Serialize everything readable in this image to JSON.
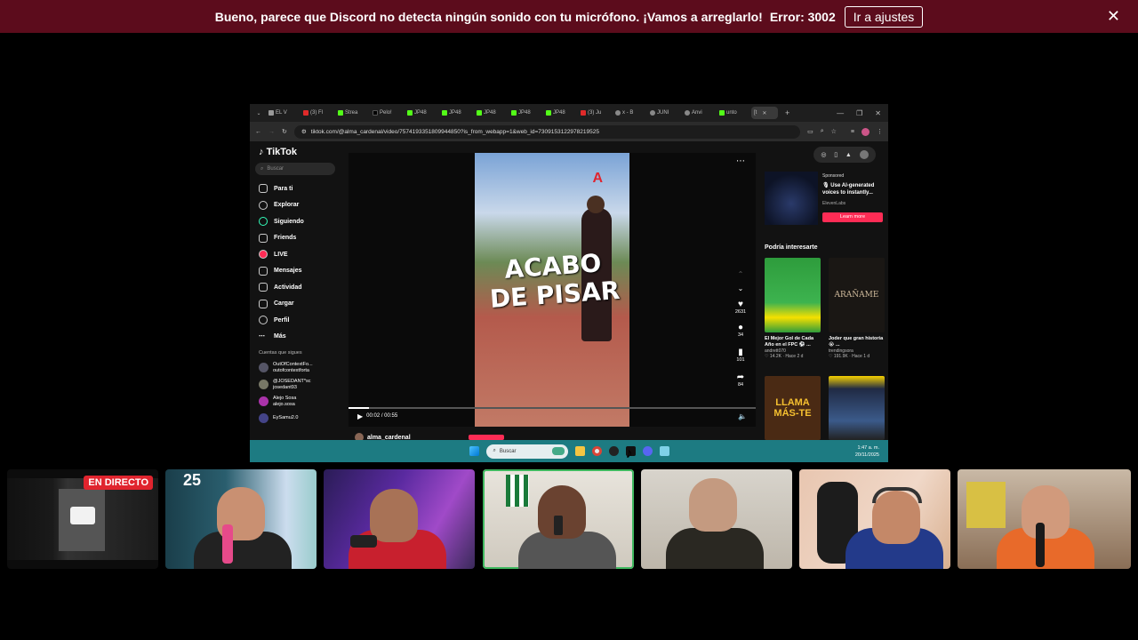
{
  "banner": {
    "message": "Bueno, parece que Discord no detecta ningún sonido con tu micrófono. ¡Vamos a arreglarlo!",
    "error": "Error: 3002",
    "button": "Ir a ajustes",
    "close_icon": "close-icon"
  },
  "browser": {
    "tabs": [
      "EL V",
      "(3) Fl",
      "Strea",
      "Pelo!",
      "JP48",
      "JP48",
      "JP48",
      "JP48",
      "JP48",
      "(3) Ju",
      "x - B",
      "JUNI",
      "Anvi",
      "unto",
      "[t"
    ],
    "url": "tiktok.com/@alma_cardenal/video/7574193351809944850?is_from_webapp=1&web_id=7309153122978219525"
  },
  "tiktok": {
    "logo": "TikTok",
    "search_placeholder": "Buscar",
    "nav": [
      "Para ti",
      "Explorar",
      "Siguiendo",
      "Friends",
      "LIVE",
      "Mensajes",
      "Actividad",
      "Cargar",
      "Perfil",
      "Más"
    ],
    "following_header": "Cuentas que sigues",
    "following": [
      {
        "name": "OutOfContextFo...",
        "handle": "outofcontextforta"
      },
      {
        "name": "@JOSEDANT*sc",
        "handle": "josedant93"
      },
      {
        "name": "Alejo Sosa",
        "handle": "alejo.sosa"
      },
      {
        "name": "EySamu2.0",
        "handle": ""
      }
    ],
    "video": {
      "caption": "ACABO DE PISAR",
      "time": "00:02 / 00:55",
      "progress": 0.05,
      "author": "alma_cardenal",
      "likes": "2631",
      "comments": "34",
      "saves": "101",
      "shares": "84"
    },
    "ad": {
      "label": "Sponsored",
      "text": "🎙 Use AI-generated voices to instantly...",
      "brand": "ElevenLabs",
      "cta": "Learn more"
    },
    "recommend_header": "Podría interesarte",
    "cards": [
      {
        "title": "El Mejor Gol de Cada Año en el FPC ⚽ ...",
        "user": "andrett070",
        "meta": "♡ 14.2K · Hace 2 d"
      },
      {
        "title": "Joder que gran historia 😭 ...",
        "user": "trendingsora",
        "meta": "♡ 191.9K · Hace 1 d"
      },
      {
        "title": "",
        "user": "",
        "meta": ""
      },
      {
        "title": "",
        "user": "",
        "meta": ""
      }
    ],
    "card_overlays": [
      "ARAÑAME",
      "LLAMA MÁS-TE"
    ]
  },
  "taskbar": {
    "search": "Buscar",
    "time": "1:47 a. m.",
    "date": "20/11/2025"
  },
  "participants": {
    "live_badge": "EN DIRECTO",
    "jersey_number": "25"
  }
}
